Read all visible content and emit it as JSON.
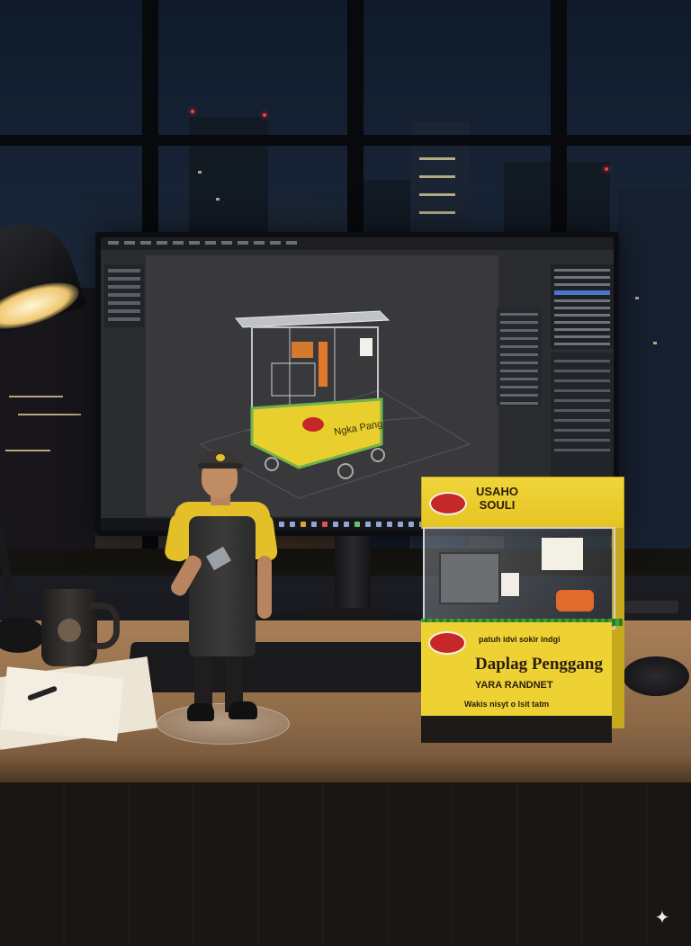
{
  "box": {
    "top_brand": "USAHO\nSOULI",
    "front_title": "Daplag Penggang",
    "front_subtitle": "YARA RANDNET",
    "front_tagline": "Wakis nisyt o lsit tatm",
    "front_small": "patuh idvi sokir indgi"
  },
  "screen": {
    "app_name": "3D modeling software"
  },
  "colors": {
    "box_yellow": "#eed233",
    "shirt_yellow": "#e3c02a",
    "apron": "#2f2e2d",
    "desk_wood": "#a77f57",
    "viewport_gray": "#39393c",
    "selection_blue": "#4a78c8"
  },
  "icons": {
    "corner_mark": "✦"
  }
}
